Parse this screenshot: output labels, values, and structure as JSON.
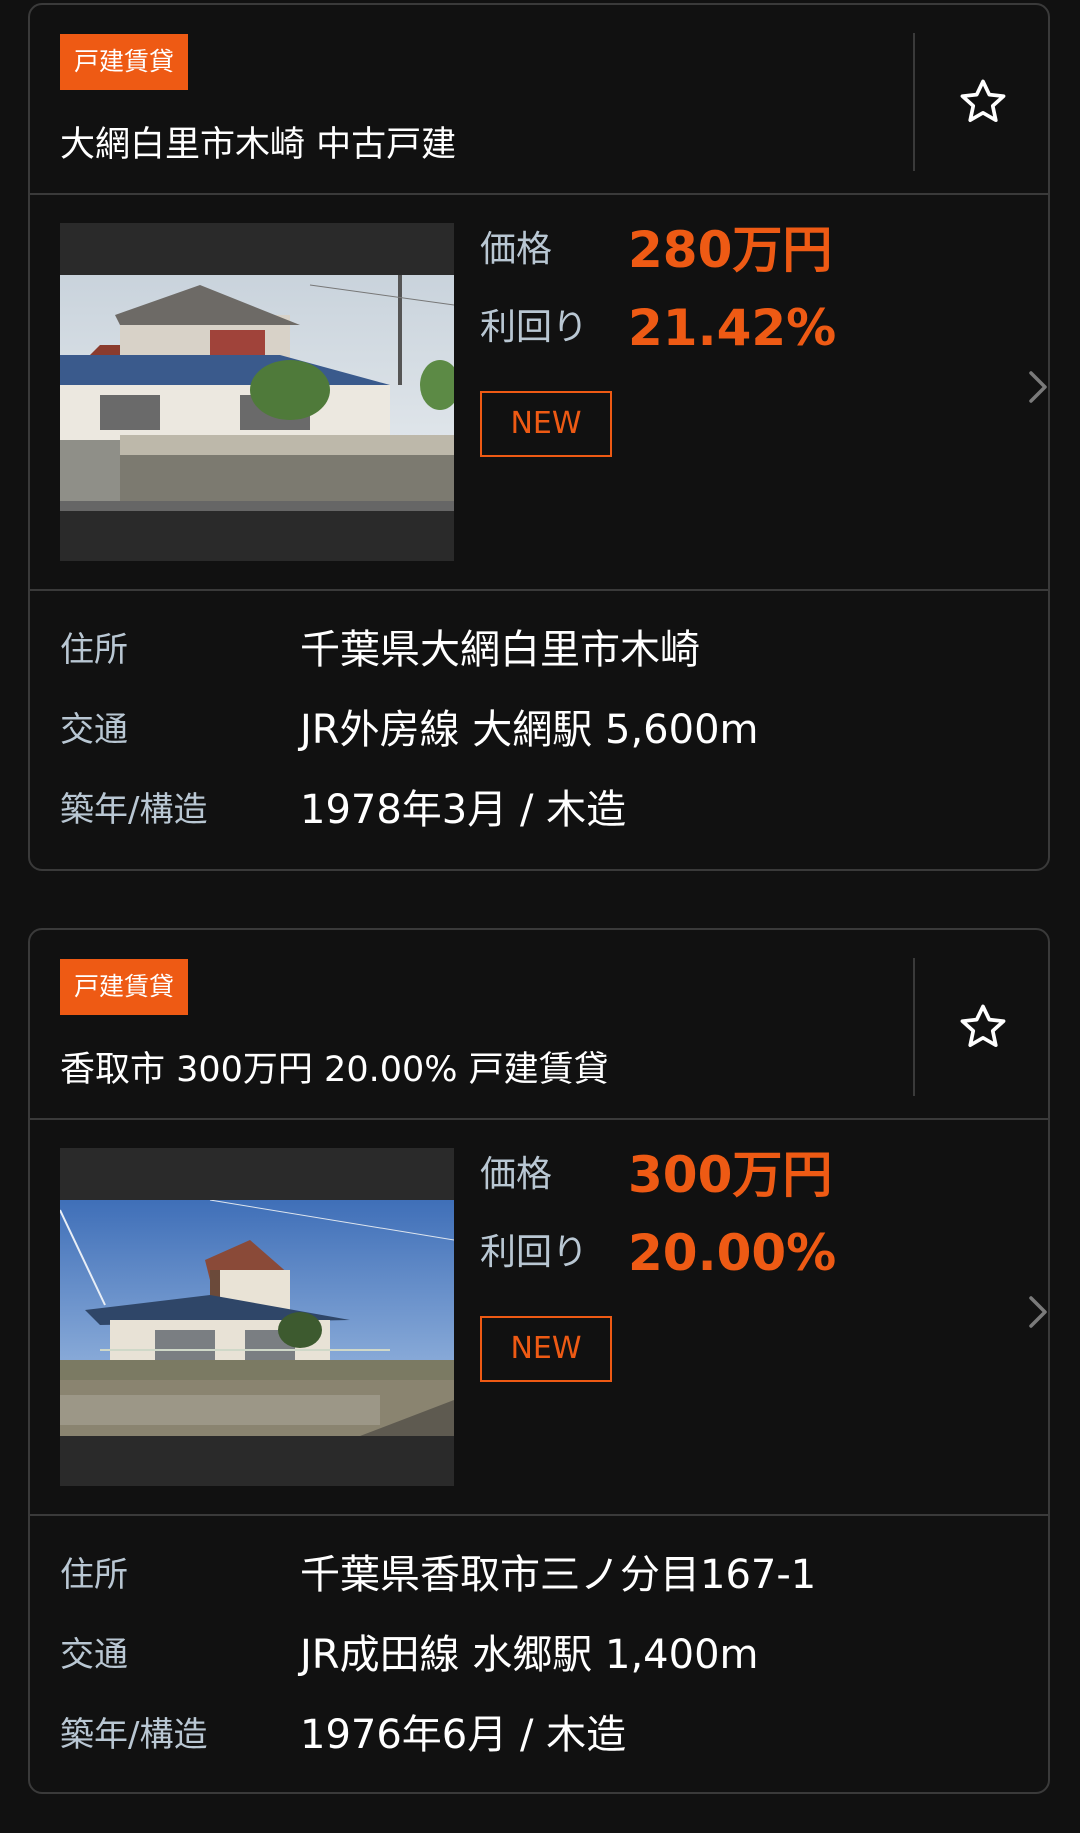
{
  "listings": [
    {
      "category_badge": "戸建賃貸",
      "title": "大網白里市木崎 中古戸建",
      "price_label": "価格",
      "price_value": "280万円",
      "yield_label": "利回り",
      "yield_value": "21.42%",
      "new_tag": "NEW",
      "address_label": "住所",
      "address_value": "千葉県大網白里市木崎",
      "transport_label": "交通",
      "transport_value": "JR外房線 大網駅 5,600m",
      "built_label": "築年/構造",
      "built_value": "1978年3月 / 木造"
    },
    {
      "category_badge": "戸建賃貸",
      "title": "香取市 300万円 20.00% 戸建賃貸",
      "price_label": "価格",
      "price_value": "300万円",
      "yield_label": "利回り",
      "yield_value": "20.00%",
      "new_tag": "NEW",
      "address_label": "住所",
      "address_value": "千葉県香取市三ノ分目167-1",
      "transport_label": "交通",
      "transport_value": "JR成田線 水郷駅 1,400m",
      "built_label": "築年/構造",
      "built_value": "1976年6月 / 木造"
    }
  ],
  "icons": {
    "favorite": "star-outline-icon",
    "detail": "chevron-right-icon"
  },
  "colors": {
    "background": "#111111",
    "accent": "#ee5a14",
    "label": "#b9c7d3",
    "border": "#3a3a3a"
  }
}
